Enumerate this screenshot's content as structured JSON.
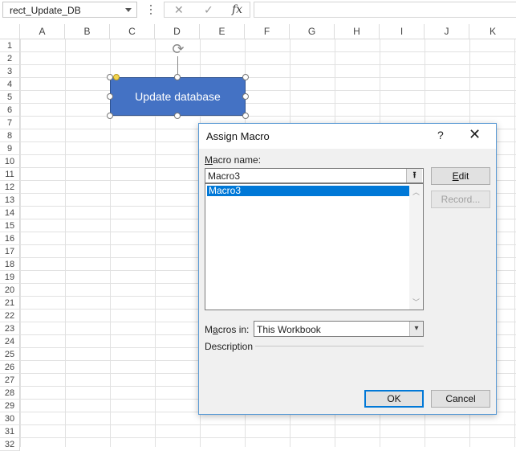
{
  "formula_bar": {
    "name_box_value": "rect_Update_DB",
    "cancel_symbol": "✕",
    "enter_symbol": "✓",
    "function_symbol": "fx",
    "formula_value": ""
  },
  "columns": [
    "A",
    "B",
    "C",
    "D",
    "E",
    "F",
    "G",
    "H",
    "I",
    "J",
    "K"
  ],
  "rows": [
    "1",
    "2",
    "3",
    "4",
    "5",
    "6",
    "7",
    "8",
    "9",
    "10",
    "11",
    "12",
    "13",
    "14",
    "15",
    "16",
    "17",
    "18",
    "19",
    "20",
    "21",
    "22",
    "23",
    "24",
    "25",
    "26",
    "27",
    "28",
    "29",
    "30",
    "31",
    "32"
  ],
  "shape": {
    "text": "Update database",
    "fill_color": "#4472c4"
  },
  "dialog": {
    "title": "Assign Macro",
    "help_symbol": "?",
    "close_symbol": "✕",
    "macro_name_label_access": "M",
    "macro_name_label_rest": "acro name:",
    "macro_name_value": "Macro3",
    "macro_list": [
      "Macro3"
    ],
    "edit_label_access": "E",
    "edit_label_rest": "dit",
    "record_label": "Record...",
    "macros_in_label_pre": "M",
    "macros_in_label_access": "a",
    "macros_in_label_rest": "cros in:",
    "macros_in_value": "This Workbook",
    "description_label": "Description",
    "ok_label": "OK",
    "cancel_label": "Cancel"
  }
}
